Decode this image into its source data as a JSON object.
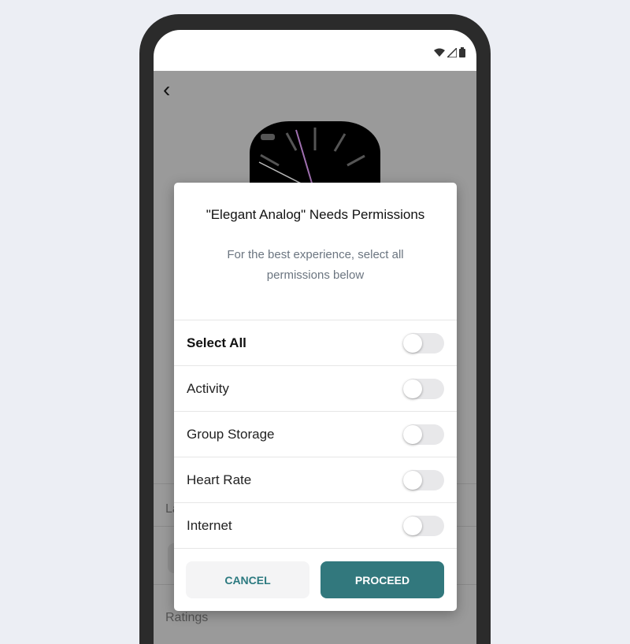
{
  "dialog": {
    "title": "\"Elegant Analog\" Needs Permissions",
    "subtitle": "For the best experience, select all permissions below",
    "permissions": [
      {
        "label": "Select All",
        "enabled": false
      },
      {
        "label": "Activity",
        "enabled": false
      },
      {
        "label": "Group Storage",
        "enabled": false
      },
      {
        "label": "Heart Rate",
        "enabled": false
      },
      {
        "label": "Internet",
        "enabled": false
      }
    ],
    "cancel_label": "CANCEL",
    "proceed_label": "PROCEED"
  },
  "background": {
    "section_label": "La",
    "ratings_label": "Ratings"
  },
  "colors": {
    "accent": "#32787d",
    "overlay": "#9a9a9a",
    "watch_hand": "#a070b0"
  }
}
